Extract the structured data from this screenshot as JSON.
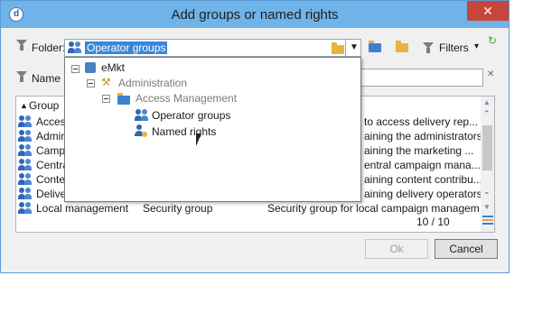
{
  "window": {
    "title": "Add groups or named rights",
    "close_glyph": "✕"
  },
  "folder": {
    "label": "Folder:",
    "value": "Operator groups",
    "filters_label": "Filters",
    "filters_caret": "▾"
  },
  "search": {
    "label": "Name",
    "clear_glyph": "✕"
  },
  "list": {
    "column_header": "Group",
    "rows": [
      {
        "name": "Acces",
        "type": "",
        "description": "to access delivery rep..."
      },
      {
        "name": "Admin",
        "type": "",
        "description": "aining the administrators"
      },
      {
        "name": "Camp",
        "type": "",
        "description": "aining the marketing ..."
      },
      {
        "name": "Centra",
        "type": "",
        "description": "entral campaign mana..."
      },
      {
        "name": "Conte",
        "type": "",
        "description": "aining content contribu..."
      },
      {
        "name": "Delive",
        "type": "",
        "description": "aining delivery operators"
      },
      {
        "name": "Local management",
        "type": "Security group",
        "description": "Security group for local campaign managem"
      }
    ],
    "count": "10 / 10"
  },
  "tree": {
    "items": [
      {
        "label": "eMkt"
      },
      {
        "label": "Administration"
      },
      {
        "label": "Access Management"
      },
      {
        "label": "Operator groups"
      },
      {
        "label": "Named rights"
      }
    ]
  },
  "buttons": {
    "ok": "Ok",
    "cancel": "Cancel"
  },
  "colors": {
    "title_bar": "#6fb3e8",
    "close": "#c7453b",
    "selection": "#3a86d8"
  }
}
